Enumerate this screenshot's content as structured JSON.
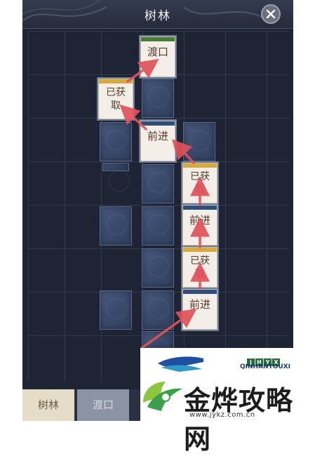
{
  "header": {
    "title": "树林"
  },
  "close": {
    "icon": "close-icon"
  },
  "cards": {
    "ferry": {
      "label": "渡口",
      "bar_color": "#4a7a3a"
    },
    "obtained_top": {
      "label": "已获取",
      "bar_color": "#d8a83a"
    },
    "advance_top": {
      "label": "前进",
      "bar_color": "#2f4e7a"
    },
    "obtained_mid": {
      "label": "已获取",
      "bar_color": "#d8a83a"
    },
    "advance_mid": {
      "label": "前进",
      "bar_color": "#2f4e7a"
    },
    "obtained_low": {
      "label": "已获取",
      "bar_color": "#d8a83a"
    },
    "advance_low": {
      "label": "前进",
      "bar_color": "#2f4e7a"
    }
  },
  "tabs": [
    {
      "label": "树林",
      "active": true
    },
    {
      "label": "渡口",
      "active": false
    }
  ],
  "watermark": {
    "brand_boxes": [
      "J",
      "H",
      "Y",
      "X"
    ],
    "pinyin": "QINHANYOUXI",
    "name": "金烨攻略网",
    "url": "www.jykz.com.cn"
  },
  "colors": {
    "panel_bg": "#1e2434",
    "tile": "#3a4a6c",
    "arrow": "#e0525a",
    "ferry_bar": "#4a7a3a",
    "obtained_bar": "#d8a83a",
    "advance_bar": "#2f4e7a"
  }
}
